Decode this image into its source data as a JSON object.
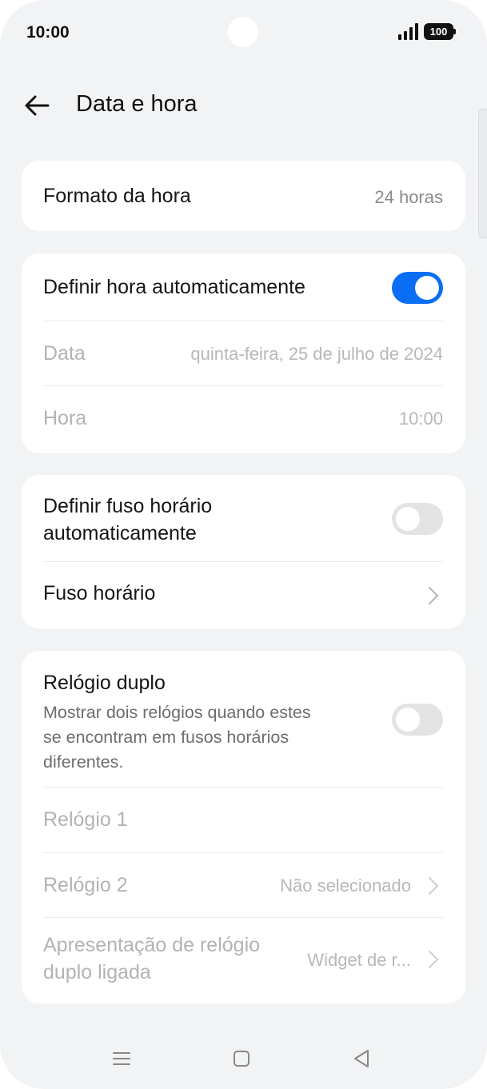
{
  "status_bar": {
    "time": "10:00",
    "battery": "100"
  },
  "header": {
    "title": "Data e hora",
    "back_icon": "arrow-left-icon"
  },
  "time_format": {
    "label": "Formato da hora",
    "value": "24 horas"
  },
  "auto_time": {
    "label": "Definir hora automaticamente",
    "enabled": true,
    "date_label": "Data",
    "date_value": "quinta-feira, 25 de julho de 2024",
    "time_label": "Hora",
    "time_value": "10:00"
  },
  "timezone": {
    "auto_label_line1": "Definir fuso horário",
    "auto_label_line2": "automaticamente",
    "auto_enabled": false,
    "zone_label": "Fuso horário"
  },
  "dual_clock": {
    "label": "Relógio duplo",
    "description_line1": "Mostrar dois relógios quando estes",
    "description_line2": "se encontram em fusos horários",
    "description_line3": "diferentes.",
    "enabled": false,
    "clock1_label": "Relógio 1",
    "clock2_label": "Relógio 2",
    "clock2_value": "Não selecionado",
    "display_label_line1": "Apresentação de relógio",
    "display_label_line2": "duplo ligada",
    "display_value": "Widget de r..."
  },
  "nav": {
    "menu_icon": "menu-icon",
    "home_icon": "home-square-icon",
    "back_icon": "back-triangle-icon"
  },
  "colors": {
    "accent": "#0a6ef5",
    "background": "#f2f3f5",
    "card": "#ffffff"
  }
}
